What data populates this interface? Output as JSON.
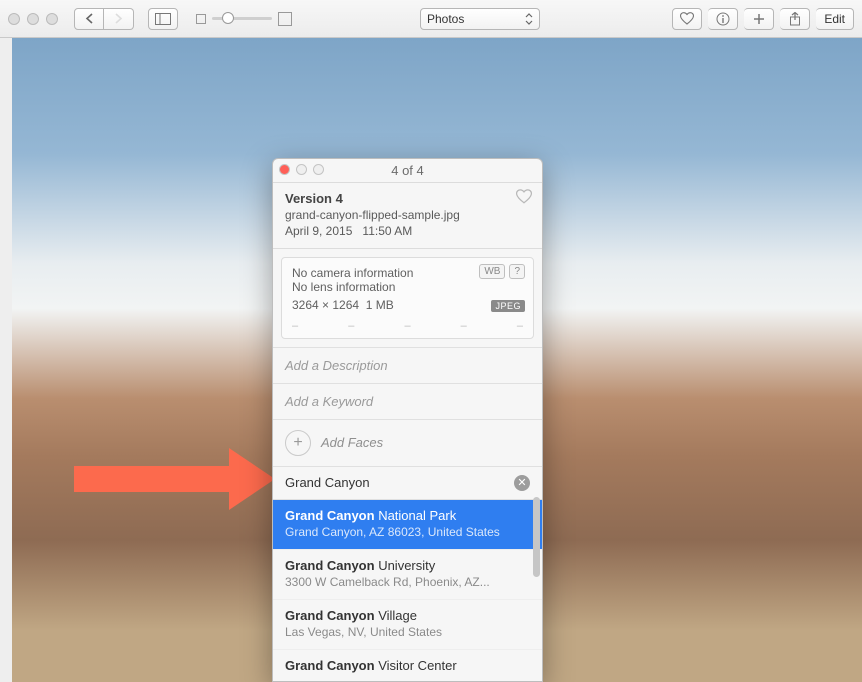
{
  "toolbar": {
    "view_selector": "Photos",
    "edit_label": "Edit"
  },
  "panel": {
    "counter": "4 of 4",
    "header": {
      "version": "Version 4",
      "filename": "grand-canyon-flipped-sample.jpg",
      "date": "April 9, 2015",
      "time": "11:50 AM"
    },
    "camera": {
      "camera_line": "No camera information",
      "lens_line": "No lens information",
      "dimensions": "3264 × 1264",
      "filesize": "1 MB",
      "format_badge": "JPEG",
      "wb_badge": "WB",
      "help_badge": "?"
    },
    "description_placeholder": "Add a Description",
    "keyword_placeholder": "Add a Keyword",
    "faces_label": "Add Faces",
    "location_input": "Grand Canyon",
    "suggestions": [
      {
        "prefix": "Grand Canyon",
        "suffix": " National Park",
        "subtitle": "Grand Canyon, AZ 86023, United States",
        "selected": true
      },
      {
        "prefix": "Grand Canyon",
        "suffix": " University",
        "subtitle": "3300 W Camelback Rd, Phoenix, AZ...",
        "selected": false
      },
      {
        "prefix": "Grand Canyon",
        "suffix": " Village",
        "subtitle": "Las Vegas, NV, United States",
        "selected": false
      },
      {
        "prefix": "Grand Canyon",
        "suffix": " Visitor Center",
        "subtitle": "",
        "selected": false
      }
    ]
  }
}
